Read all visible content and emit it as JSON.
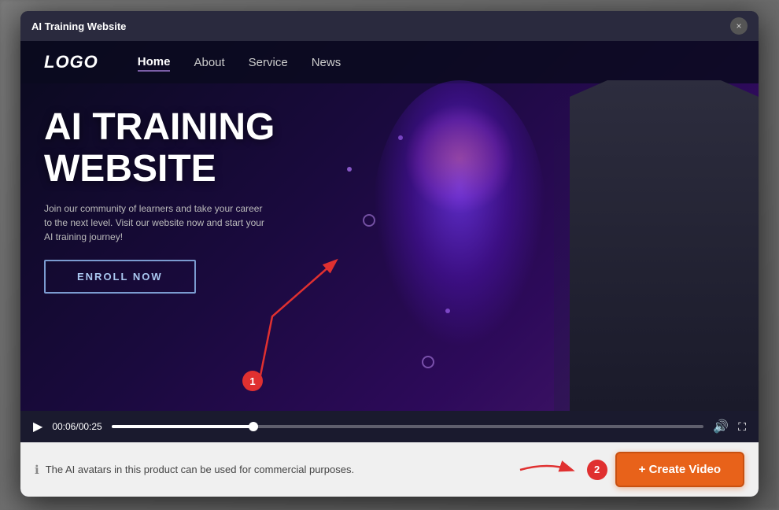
{
  "modal": {
    "title": "AI Training Website",
    "close_label": "×"
  },
  "nav": {
    "logo": "LOGO",
    "items": [
      {
        "label": "Home",
        "active": true
      },
      {
        "label": "About",
        "active": false
      },
      {
        "label": "Service",
        "active": false
      },
      {
        "label": "News",
        "active": false
      }
    ]
  },
  "hero": {
    "title_line1": "AI TRAINING",
    "title_line2": "WEBSITE",
    "subtitle": "Join our community of learners and take your career to the next level. Visit our website now and start your AI training journey!",
    "cta_button": "ENROLL NOW"
  },
  "video_controls": {
    "current_time": "00:06",
    "total_time": "00:25",
    "progress_percent": 24
  },
  "bottom_bar": {
    "info_text": "The AI avatars in this product can be used for commercial purposes.",
    "create_button": "+ Create Video"
  },
  "annotations": {
    "badge1_label": "1",
    "badge2_label": "2"
  },
  "colors": {
    "accent_orange": "#e8621a",
    "accent_red": "#e03030",
    "nav_bg": "rgba(10,10,30,0.85)",
    "modal_bg": "#1a1a2e"
  }
}
